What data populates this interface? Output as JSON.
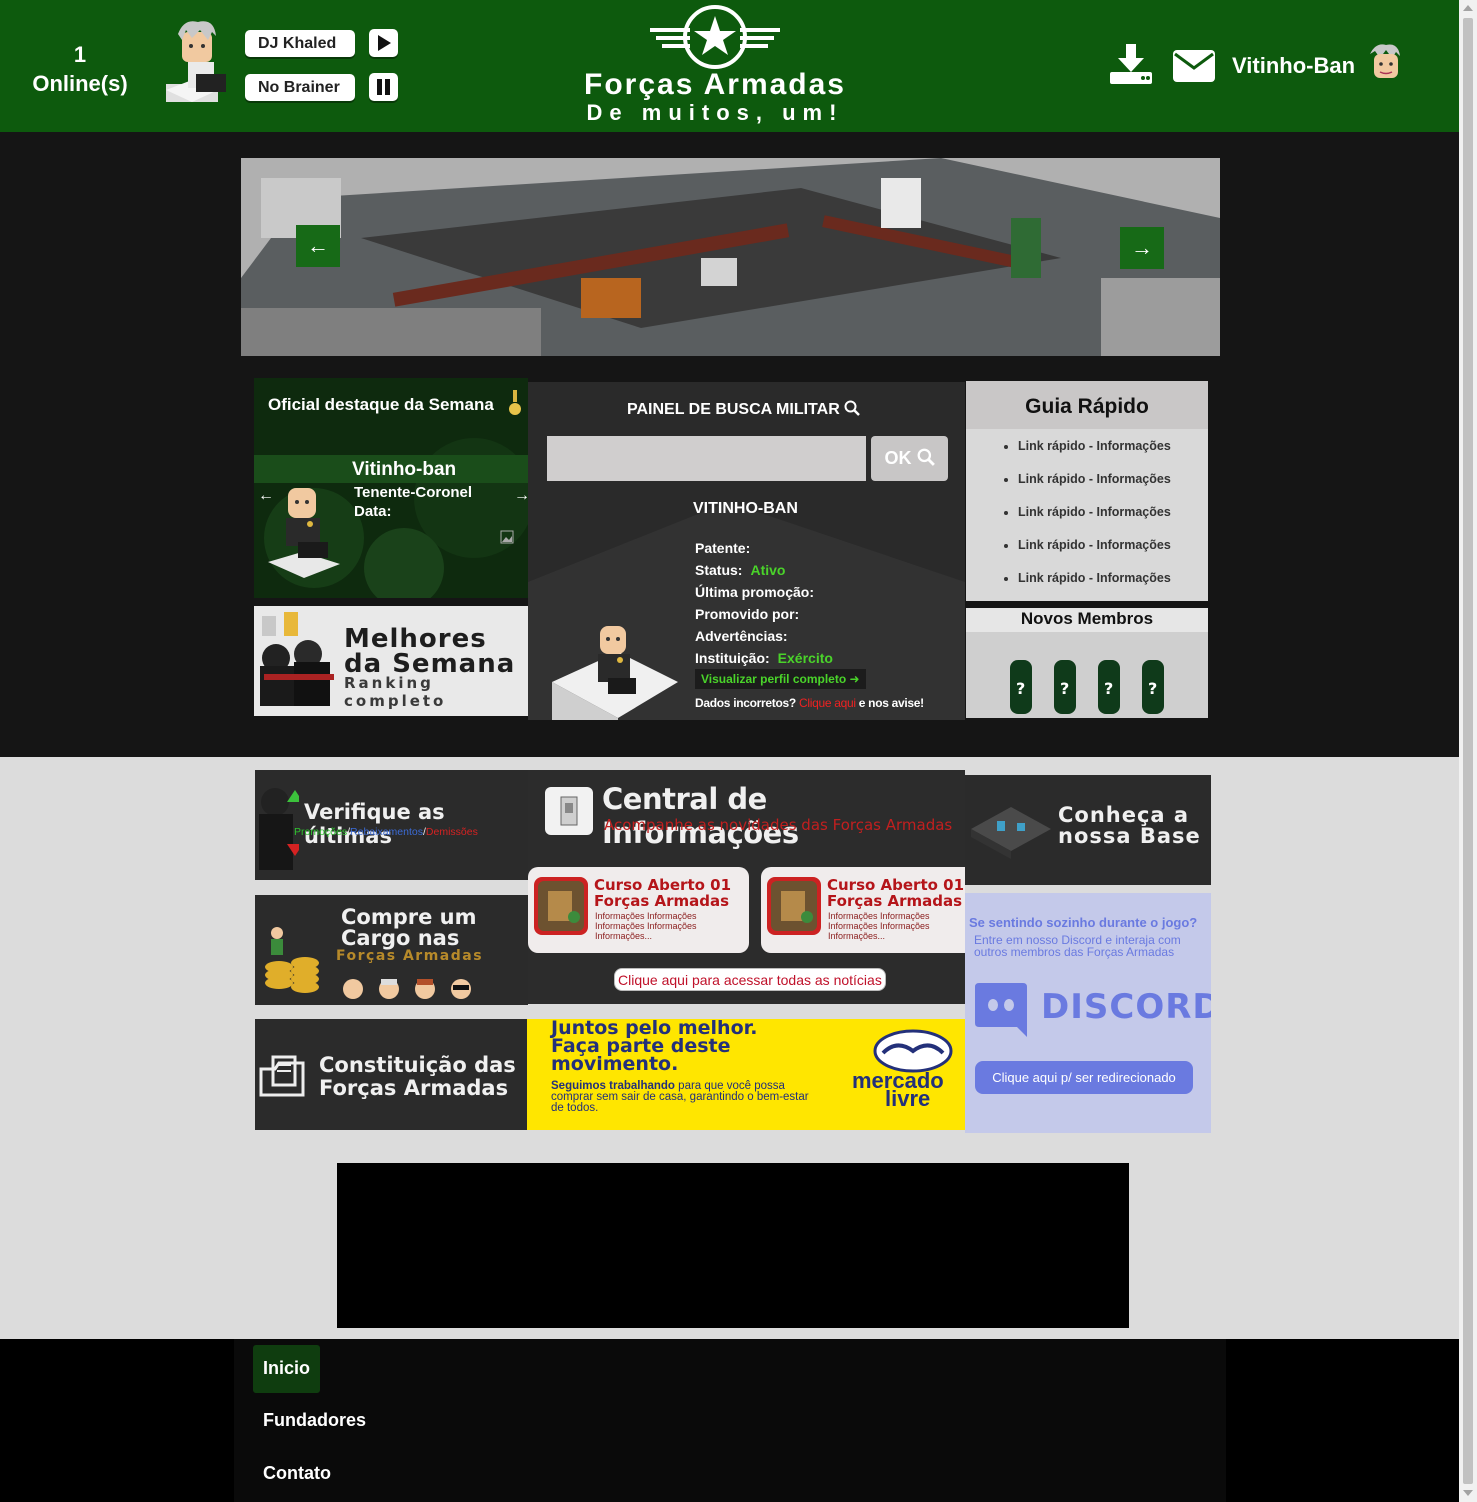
{
  "header": {
    "online_count": "1",
    "online_label": "Online(s)",
    "dj_name": "DJ Khaled",
    "track_name": "No Brainer",
    "site_title": "Forças Armadas",
    "site_subtitle": "De muitos, um!",
    "user_name": "Vitinho-Ban"
  },
  "destaque": {
    "title": "Oficial destaque da Semana",
    "name": "Vitinho-ban",
    "rank": "Tenente-Coronel",
    "date_label": "Data:"
  },
  "melhores": {
    "line1": "Melhores",
    "line2": "da Semana",
    "line3": "Ranking completo"
  },
  "busca": {
    "title": "PAINEL DE BUSCA MILITAR",
    "input_value": "",
    "ok_label": "OK",
    "user": "VITINHO-BAN",
    "patente_label": "Patente:",
    "status_label": "Status:",
    "status_value": "Ativo",
    "promocao_label": "Última promoção:",
    "promovido_label": "Promovido por:",
    "advertencias_label": "Advertências:",
    "instituicao_label": "Instituição:",
    "instituicao_value": "Exército",
    "view_profile": "Visualizar perfil completo",
    "wrong_prefix": "Dados incorretos?",
    "wrong_link": "Clique aqui",
    "wrong_suffix": "e nos avise!"
  },
  "guia": {
    "title": "Guia Rápido",
    "links": [
      "Link rápido - Informações",
      "Link rápido - Informações",
      "Link rápido - Informações",
      "Link rápido - Informações",
      "Link rápido - Informações"
    ]
  },
  "novos": {
    "title": "Novos Membros",
    "placeholder_mark": "?"
  },
  "banners": {
    "verifique": {
      "title": "Verifique as últimas",
      "promocoes": "Promoções",
      "rebaixamentos": "Rebaixamentos",
      "demissoes": "Demissões"
    },
    "cargo": {
      "line1": "Compre um",
      "line2": "Cargo nas",
      "line3": "Forças Armadas"
    },
    "constituicao": {
      "line1": "Constituição das",
      "line2": "Forças Armadas"
    },
    "base": {
      "line1": "Conheça a",
      "line2": "nossa Base"
    },
    "central": {
      "title": "Central de Informações",
      "subtitle": "Acompanhe as novidades das Forças Armadas",
      "cards": [
        {
          "title1": "Curso Aberto 01",
          "title2": "Forças Armadas",
          "text": "Informações Informações Informações Informações Informações..."
        },
        {
          "title1": "Curso Aberto 01",
          "title2": "Forças Armadas",
          "text": "Informações Informações Informações Informações Informações..."
        }
      ],
      "all_news": "Clique aqui para acessar todas as notícias"
    },
    "discord": {
      "line1": "Se sentindo sozinho durante o jogo?",
      "line2": "Entre em nosso Discord e interaja com",
      "line3": "outros membros das Forças Armadas",
      "logo_text": "DISCORD",
      "button": "Clique aqui p/ ser redirecionado"
    },
    "mercado": {
      "line1": "Juntos pelo melhor.",
      "line2": "Faça parte deste",
      "line3": "movimento.",
      "body_bold": "Seguimos trabalhando",
      "body_rest": "para que você possa comprar sem sair de casa, garantindo o bem-estar de todos.",
      "brand1": "mercado",
      "brand2": "livre"
    }
  },
  "footer": {
    "nav": [
      "Inicio",
      "Fundadores",
      "Contato"
    ]
  },
  "colors": {
    "header_green": "#0d5a0d",
    "active_green": "#0f3d0f",
    "status_green": "#4ad32a",
    "link_red": "#e22222"
  }
}
